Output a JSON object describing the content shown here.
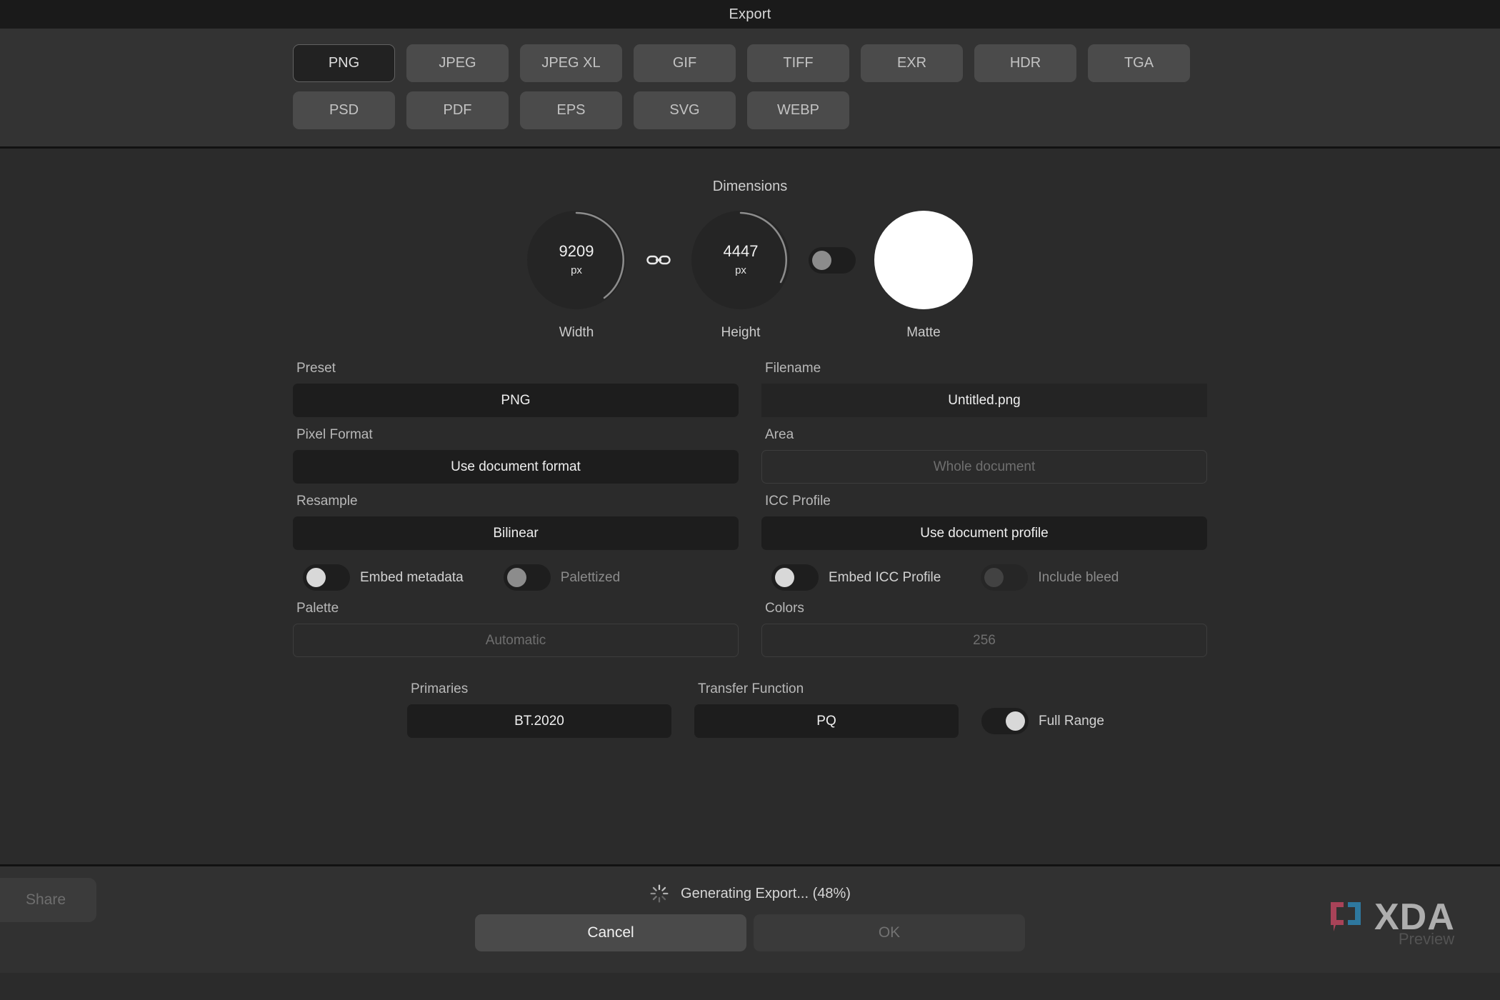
{
  "window": {
    "title": "Export"
  },
  "formats": {
    "selected": "PNG",
    "row1": [
      {
        "label": "PNG"
      },
      {
        "label": "JPEG"
      },
      {
        "label": "JPEG XL"
      },
      {
        "label": "GIF"
      },
      {
        "label": "TIFF"
      },
      {
        "label": "EXR"
      },
      {
        "label": "HDR"
      },
      {
        "label": "TGA"
      }
    ],
    "row2": [
      {
        "label": "PSD"
      },
      {
        "label": "PDF"
      },
      {
        "label": "EPS"
      },
      {
        "label": "SVG"
      },
      {
        "label": "WEBP"
      }
    ]
  },
  "dimensions": {
    "heading": "Dimensions",
    "width": {
      "value": "9209",
      "unit": "px",
      "label": "Width"
    },
    "height": {
      "value": "4447",
      "unit": "px",
      "label": "Height"
    },
    "matte": {
      "label": "Matte",
      "color": "#ffffff"
    },
    "link_icon": "link-chain-icon",
    "lock_aspect": {
      "state": "off"
    }
  },
  "fields": {
    "preset": {
      "label": "Preset",
      "value": "PNG"
    },
    "filename": {
      "label": "Filename",
      "value": "Untitled.png"
    },
    "pixel_format": {
      "label": "Pixel Format",
      "value": "Use document format"
    },
    "area": {
      "label": "Area",
      "value": "Whole document",
      "state": "disabled"
    },
    "resample": {
      "label": "Resample",
      "value": "Bilinear"
    },
    "icc_profile": {
      "label": "ICC Profile",
      "value": "Use document profile"
    },
    "palette": {
      "label": "Palette",
      "value": "Automatic",
      "state": "disabled"
    },
    "colors": {
      "label": "Colors",
      "value": "256",
      "state": "disabled"
    },
    "primaries": {
      "label": "Primaries",
      "value": "BT.2020"
    },
    "transfer_function": {
      "label": "Transfer Function",
      "value": "PQ"
    }
  },
  "toggles": {
    "embed_metadata": {
      "label": "Embed metadata",
      "state": "off"
    },
    "palettized": {
      "label": "Palettized",
      "state": "off-muted"
    },
    "embed_icc_profile": {
      "label": "Embed ICC Profile",
      "state": "off"
    },
    "include_bleed": {
      "label": "Include bleed",
      "state": "disabled"
    },
    "full_range": {
      "label": "Full Range",
      "state": "on"
    }
  },
  "footer": {
    "status": "Generating Export... (48%)",
    "progress_percent": "48",
    "spinner_icon": "loading-spinner-icon",
    "share_label": "Share",
    "cancel_label": "Cancel",
    "ok_label": "OK"
  },
  "watermark": {
    "brand": "XDA",
    "sub": "Preview",
    "bracket_left_color": "#b3455c",
    "bracket_right_color": "#2e7fa8"
  }
}
